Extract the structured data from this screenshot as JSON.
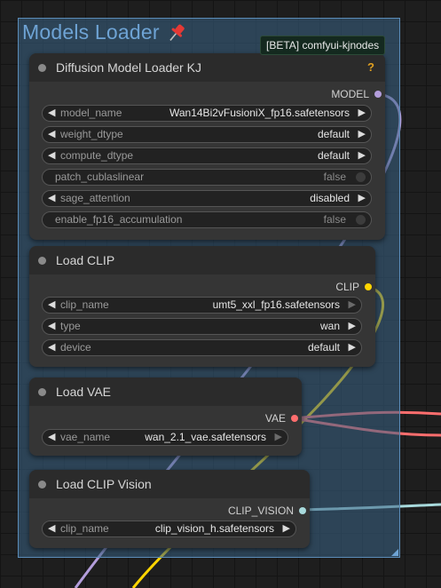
{
  "group": {
    "title": "Models Loader",
    "pin_icon": "pushpin-icon"
  },
  "badge": "[BETA] comfyui-kjnodes",
  "colors": {
    "model": "#b39ddb",
    "clip": "#ffd500",
    "vae": "#ff6e6e",
    "clip_vision": "#a8dadc"
  },
  "nodes": {
    "diffusion": {
      "title": "Diffusion Model Loader KJ",
      "help": "?",
      "output": "MODEL",
      "widgets": [
        {
          "name": "model_name",
          "value": "Wan14Bi2vFusioniX_fp16.safetensors"
        },
        {
          "name": "weight_dtype",
          "value": "default"
        },
        {
          "name": "compute_dtype",
          "value": "default"
        },
        {
          "name": "patch_cublaslinear",
          "value": "false"
        },
        {
          "name": "sage_attention",
          "value": "disabled"
        },
        {
          "name": "enable_fp16_accumulation",
          "value": "false"
        }
      ]
    },
    "clip": {
      "title": "Load CLIP",
      "output": "CLIP",
      "widgets": [
        {
          "name": "clip_name",
          "value": "umt5_xxl_fp16.safetensors"
        },
        {
          "name": "type",
          "value": "wan"
        },
        {
          "name": "device",
          "value": "default"
        }
      ]
    },
    "vae": {
      "title": "Load VAE",
      "output": "VAE",
      "widgets": [
        {
          "name": "vae_name",
          "value": "wan_2.1_vae.safetensors"
        }
      ]
    },
    "clip_vision": {
      "title": "Load CLIP Vision",
      "output": "CLIP_VISION",
      "widgets": [
        {
          "name": "clip_name",
          "value": "clip_vision_h.safetensors"
        }
      ]
    }
  }
}
